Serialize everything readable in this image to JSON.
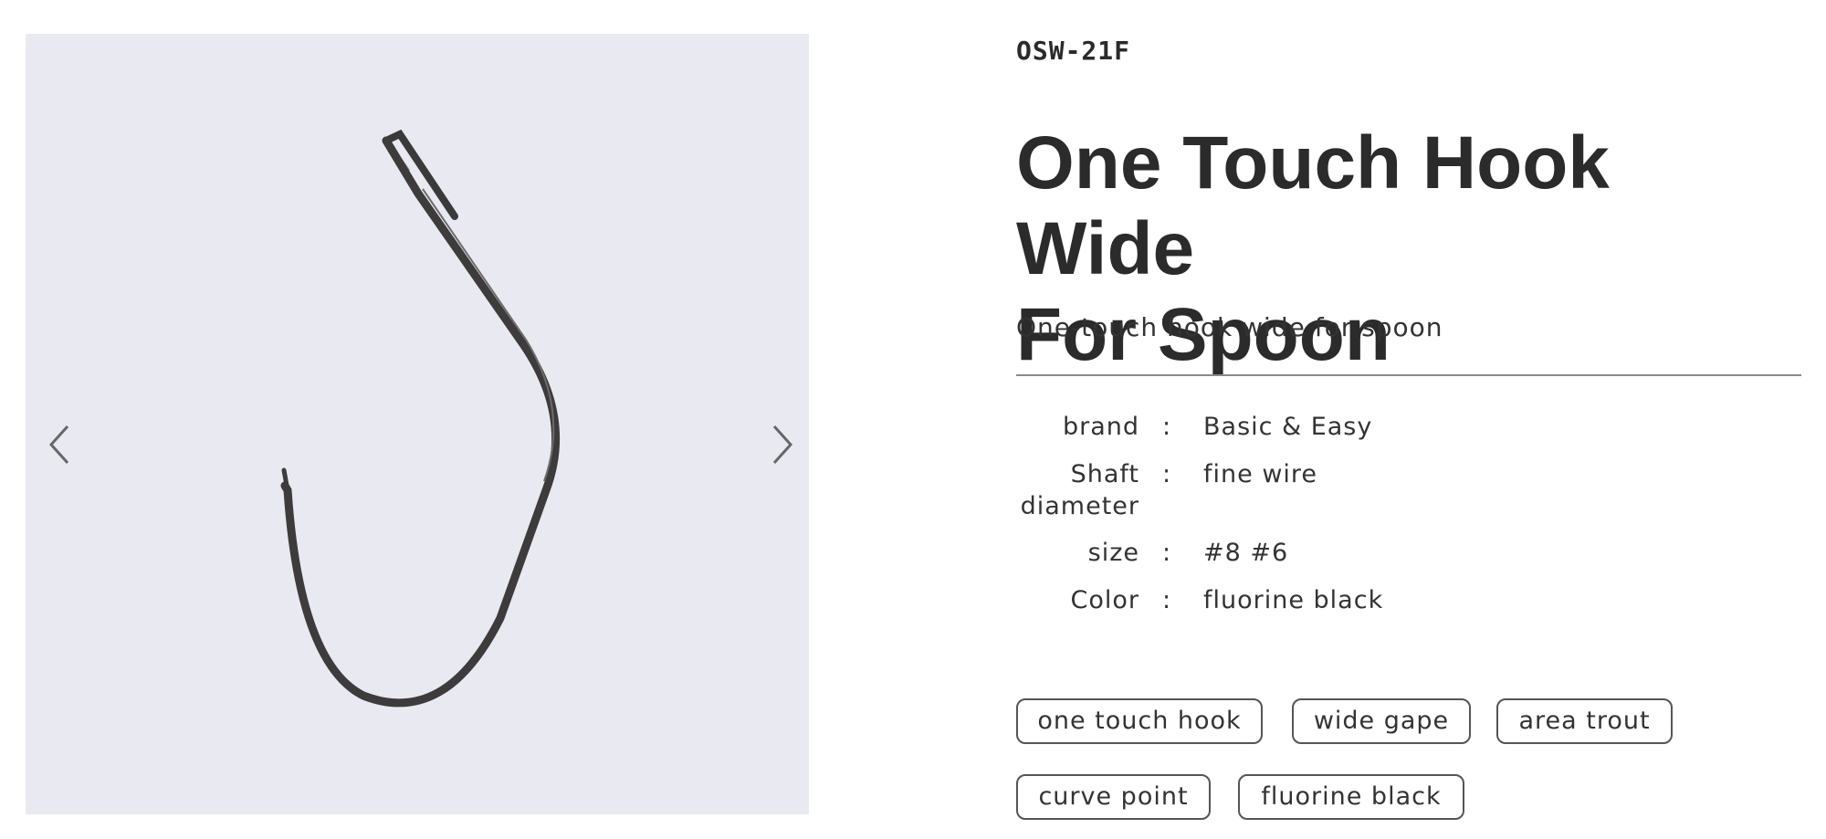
{
  "gallery": {
    "background_color": "#e9e9f1",
    "image_subject": "fishing hook",
    "prev_icon": "chevron-left-icon",
    "next_icon": "chevron-right-icon"
  },
  "product": {
    "code": "OSW-21F",
    "title_line1": "One Touch Hook Wide",
    "title_line2": "For Spoon",
    "subtitle": "One-touch hook wide for spoon"
  },
  "specs": [
    {
      "label": "brand",
      "sep": ":",
      "value": "Basic & Easy"
    },
    {
      "label": "Shaft diameter",
      "sep": ":",
      "value": "fine wire"
    },
    {
      "label": "size",
      "sep": ":",
      "value": "#8 #6"
    },
    {
      "label": "Color",
      "sep": ":",
      "value": "fluorine black"
    }
  ],
  "tags": [
    "one touch hook",
    "wide gape",
    "area trout",
    "curve point",
    "fluorine black"
  ]
}
